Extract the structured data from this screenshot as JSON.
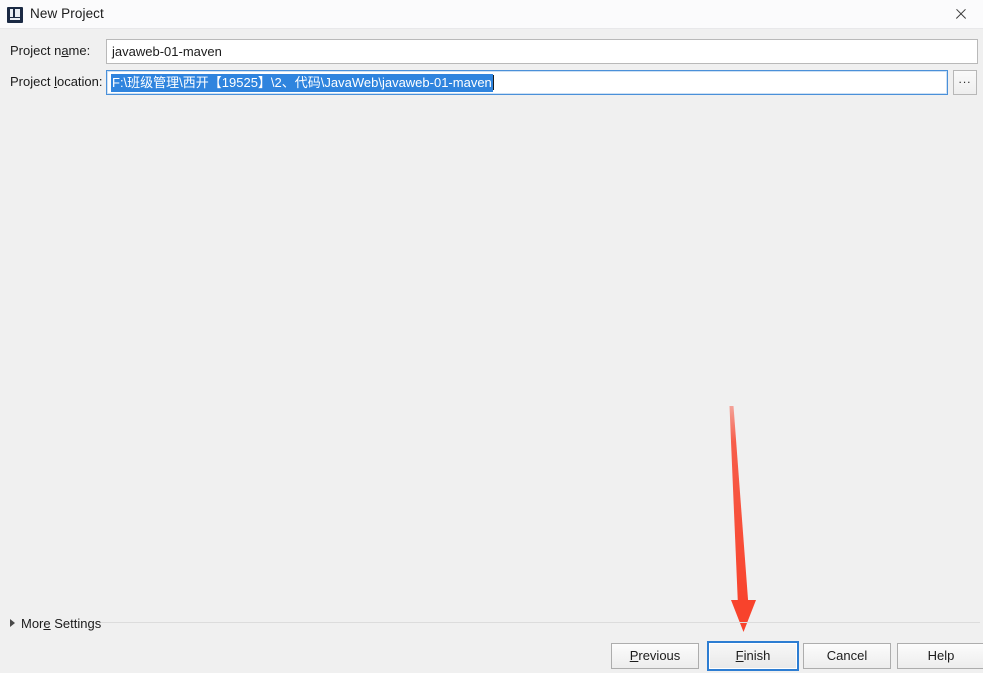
{
  "window": {
    "title": "New Project",
    "icon": "intellij-idea-icon",
    "close_label": "×",
    "accent_focus_color": "#2d7dd2",
    "selection_color": "#2f84de",
    "background_color": "#f0f0f0"
  },
  "form": {
    "project_name": {
      "label_before": "Project n",
      "label_mnemonic": "a",
      "label_after": "me:",
      "full_label": "Project name:",
      "value": "javaweb-01-maven",
      "placeholder": ""
    },
    "project_location": {
      "label_before": "Project ",
      "label_mnemonic": "l",
      "label_after": "ocation:",
      "full_label": "Project location:",
      "value": "F:\\班级管理\\西开【19525】\\2、代码\\JavaWeb\\javaweb-01-maven",
      "selected": true,
      "placeholder": ""
    },
    "browse_button_label": "..."
  },
  "footer": {
    "more_settings": {
      "label_before": "Mor",
      "label_mnemonic": "e",
      "label_after": " Settings",
      "full_label": "More Settings",
      "expanded": false,
      "chevron": "chevron-right-icon"
    },
    "buttons": [
      {
        "id": "previous",
        "before": "",
        "mnemonic": "P",
        "after": "revious",
        "full_label": "Previous",
        "focused": false,
        "enabled": true
      },
      {
        "id": "finish",
        "before": "",
        "mnemonic": "F",
        "after": "inish",
        "full_label": "Finish",
        "focused": true,
        "enabled": true
      },
      {
        "id": "cancel",
        "before": "Cancel",
        "mnemonic": "",
        "after": "",
        "full_label": "Cancel",
        "focused": false,
        "enabled": true
      },
      {
        "id": "help",
        "before": "Help",
        "mnemonic": "",
        "after": "",
        "full_label": "Help",
        "focused": false,
        "enabled": true
      }
    ]
  },
  "annotation": {
    "type": "arrow",
    "direction": "down",
    "color": "#f8432c",
    "points_to": "finish-button",
    "name": "red-arrow-annotation"
  }
}
